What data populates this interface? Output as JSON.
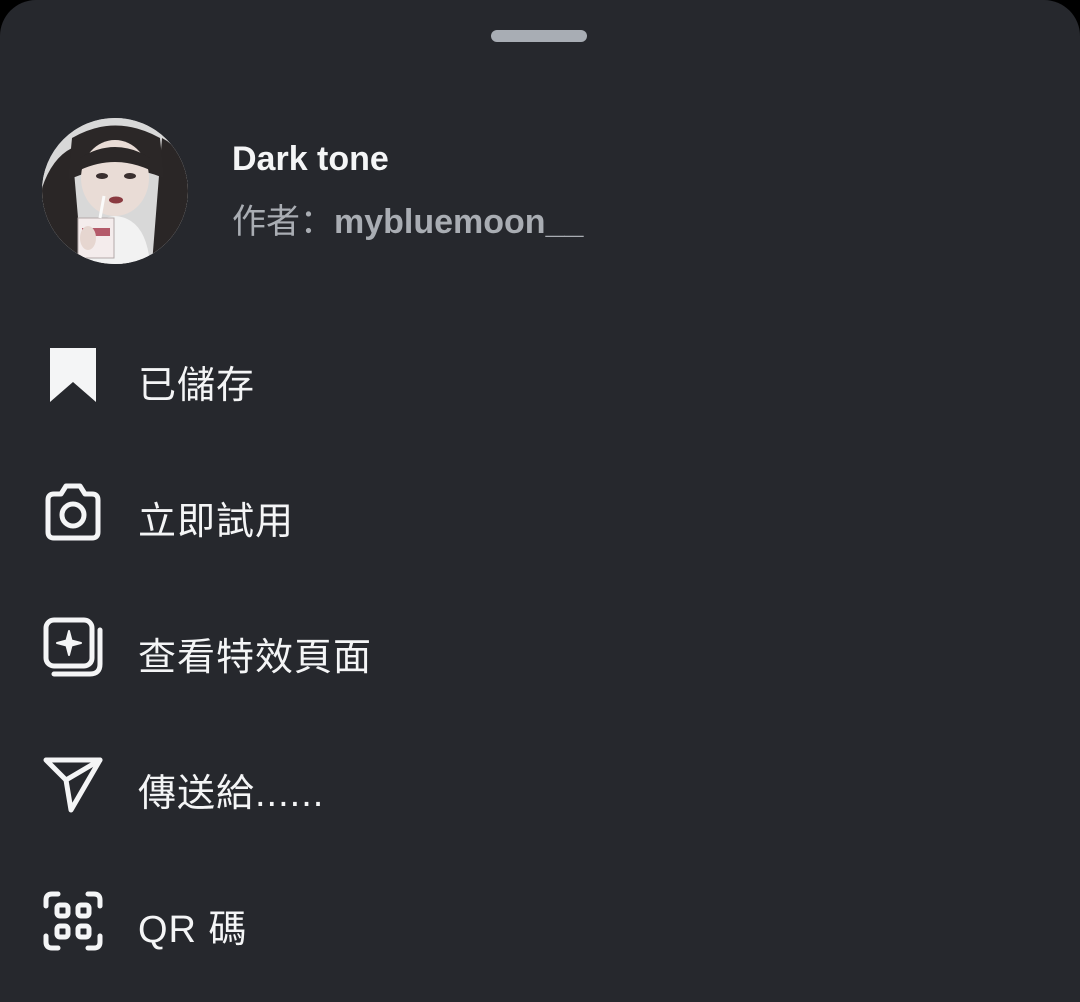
{
  "sheet": {
    "effect": {
      "title": "Dark tone",
      "author_prefix": "作者：",
      "author_name": "mybluemoon__"
    },
    "menu": [
      {
        "label": "已儲存",
        "icon": "bookmark-filled-icon"
      },
      {
        "label": "立即試用",
        "icon": "camera-icon"
      },
      {
        "label": "查看特效頁面",
        "icon": "effect-page-icon"
      },
      {
        "label": "傳送給......",
        "icon": "send-icon"
      },
      {
        "label": "QR 碼",
        "icon": "qr-code-icon"
      }
    ]
  },
  "colors": {
    "sheet_background": "#26282d",
    "handle": "#a8adb4",
    "primary_text": "#f4f5f6",
    "secondary_text": "#a9adb3"
  }
}
